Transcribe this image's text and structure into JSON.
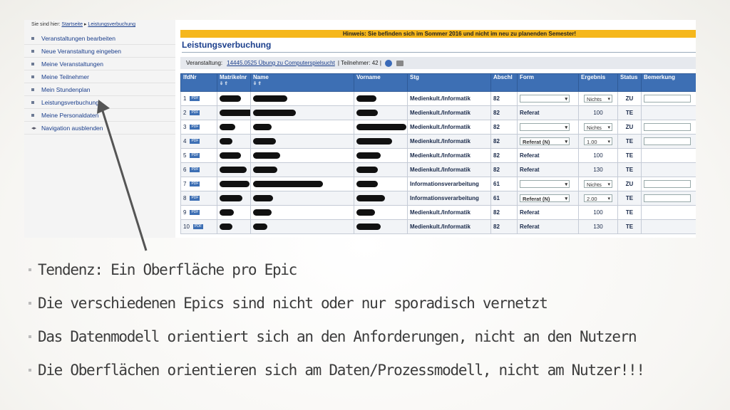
{
  "breadcrumb": {
    "prefix": "Sie sind hier:",
    "home": "Startseite",
    "sep": "▸",
    "current": "Leistungsverbuchung"
  },
  "sidebar": {
    "items": [
      {
        "label": "Veranstaltungen bearbeiten",
        "icon": "square-bullet-icon"
      },
      {
        "label": "Neue Veranstaltung eingeben",
        "icon": "square-bullet-icon"
      },
      {
        "label": "Meine Veranstaltungen",
        "icon": "square-bullet-icon"
      },
      {
        "label": "Meine Teilnehmer",
        "icon": "square-bullet-icon"
      },
      {
        "label": "Mein Stundenplan",
        "icon": "square-bullet-icon"
      },
      {
        "label": "Leistungsverbuchung",
        "icon": "square-bullet-icon"
      },
      {
        "label": "Meine Personaldaten",
        "icon": "square-bullet-icon"
      },
      {
        "label": "Navigation ausblenden",
        "icon": "arrow-left-icon"
      }
    ]
  },
  "hint": "Hinweis: Sie befinden sich im Sommer 2016 und nicht im neu zu planenden Semester!",
  "page_title": "Leistungsverbuchung",
  "veranstaltung": {
    "label": "Veranstaltung:",
    "course": "14445.0525 Übung zu Computerspielsucht",
    "sep": "|",
    "participants": "Teilnehmer: 42",
    "sep2": "|"
  },
  "table": {
    "headers": [
      "lfdNr",
      "Matrikelnr",
      "Name",
      "Vorname",
      "Stg",
      "Abschl",
      "Form",
      "Ergebnis",
      "Status",
      "Bemerkung"
    ],
    "sort_arrows": "⇩ ⇧",
    "pdf_label": "PDF",
    "rows": [
      {
        "nr": "1",
        "stg": "Medienkult./Informatik",
        "abschl": "82",
        "form": "",
        "form_type": "select",
        "ergebnis": "Nichts",
        "erg_type": "select",
        "status": "ZU",
        "bem": "input"
      },
      {
        "nr": "2",
        "stg": "Medienkult./Informatik",
        "abschl": "82",
        "form": "Referat",
        "form_type": "text",
        "ergebnis": "100",
        "erg_type": "text",
        "status": "TE",
        "bem": ""
      },
      {
        "nr": "3",
        "stg": "Medienkult./Informatik",
        "abschl": "82",
        "form": "",
        "form_type": "select",
        "ergebnis": "Nichts",
        "erg_type": "select",
        "status": "ZU",
        "bem": "input"
      },
      {
        "nr": "4",
        "stg": "Medienkult./Informatik",
        "abschl": "82",
        "form": "Referat (N)",
        "form_type": "select",
        "ergebnis": "1.00",
        "erg_type": "select",
        "status": "TE",
        "bem": "input"
      },
      {
        "nr": "5",
        "stg": "Medienkult./Informatik",
        "abschl": "82",
        "form": "Referat",
        "form_type": "text",
        "ergebnis": "100",
        "erg_type": "text",
        "status": "TE",
        "bem": ""
      },
      {
        "nr": "6",
        "stg": "Medienkult./Informatik",
        "abschl": "82",
        "form": "Referat",
        "form_type": "text",
        "ergebnis": "130",
        "erg_type": "text",
        "status": "TE",
        "bem": ""
      },
      {
        "nr": "7",
        "stg": "Informationsverarbeitung",
        "abschl": "61",
        "form": "",
        "form_type": "select",
        "ergebnis": "Nichts",
        "erg_type": "select",
        "status": "ZU",
        "bem": "input"
      },
      {
        "nr": "8",
        "stg": "Informationsverarbeitung",
        "abschl": "61",
        "form": "Referat (N)",
        "form_type": "select",
        "ergebnis": "2.00",
        "erg_type": "select",
        "status": "TE",
        "bem": "input"
      },
      {
        "nr": "9",
        "stg": "Medienkult./Informatik",
        "abschl": "82",
        "form": "Referat",
        "form_type": "text",
        "ergebnis": "100",
        "erg_type": "text",
        "status": "TE",
        "bem": ""
      },
      {
        "nr": "10",
        "stg": "Medienkult./Informatik",
        "abschl": "82",
        "form": "Referat",
        "form_type": "text",
        "ergebnis": "130",
        "erg_type": "text",
        "status": "TE",
        "bem": ""
      }
    ]
  },
  "bullets": [
    "Tendenz: Ein Oberfläche pro Epic",
    "Die verschiedenen Epics sind nicht oder nur sporadisch vernetzt",
    "Das Datenmodell orientiert sich an den Anforderungen, nicht an den Nutzern",
    "Die Oberflächen orientieren sich am Daten/Prozessmodell, nicht am Nutzer!!!"
  ],
  "colors": {
    "accent": "#3d6fb4",
    "hint_bg": "#f5b71c",
    "link": "#1a3e8c"
  }
}
